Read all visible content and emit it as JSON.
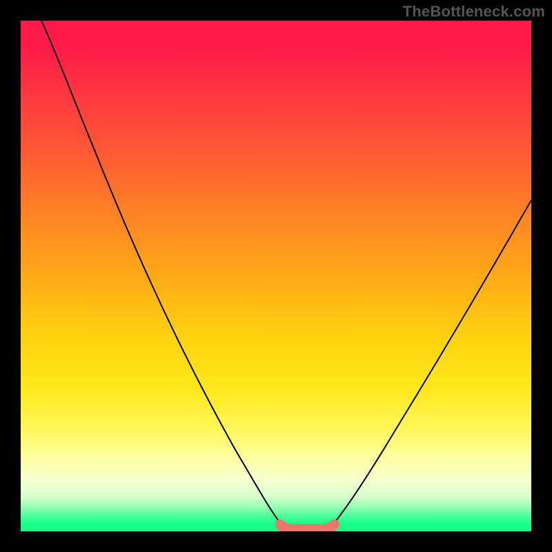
{
  "watermark": "TheBottleneck.com",
  "chart_data": {
    "type": "line",
    "title": "",
    "xlabel": "",
    "ylabel": "",
    "xlim": [
      0,
      100
    ],
    "ylim": [
      0,
      100
    ],
    "grid": false,
    "series": [
      {
        "name": "left-curve",
        "x": [
          0,
          5,
          12,
          22,
          34,
          45,
          50
        ],
        "y": [
          100,
          90,
          77,
          57,
          32,
          8,
          1
        ],
        "color": "#000000",
        "stroke_width": 1.5
      },
      {
        "name": "right-curve",
        "x": [
          60,
          66,
          74,
          82,
          90,
          100
        ],
        "y": [
          1,
          8,
          20,
          34,
          49,
          66
        ],
        "color": "#000000",
        "stroke_width": 1.5
      },
      {
        "name": "bottom-highlight",
        "x": [
          50,
          52,
          55,
          58,
          60
        ],
        "y": [
          1,
          0.3,
          0.2,
          0.3,
          1
        ],
        "color": "#ef746a",
        "stroke_width": 14,
        "linecap": "round"
      }
    ],
    "gradient_stops": [
      {
        "pos": 0,
        "color": "#ff1a4a"
      },
      {
        "pos": 0.4,
        "color": "#ff8a22"
      },
      {
        "pos": 0.72,
        "color": "#ffe81a"
      },
      {
        "pos": 0.92,
        "color": "#d8ffcc"
      },
      {
        "pos": 1.0,
        "color": "#14ff87"
      }
    ]
  }
}
